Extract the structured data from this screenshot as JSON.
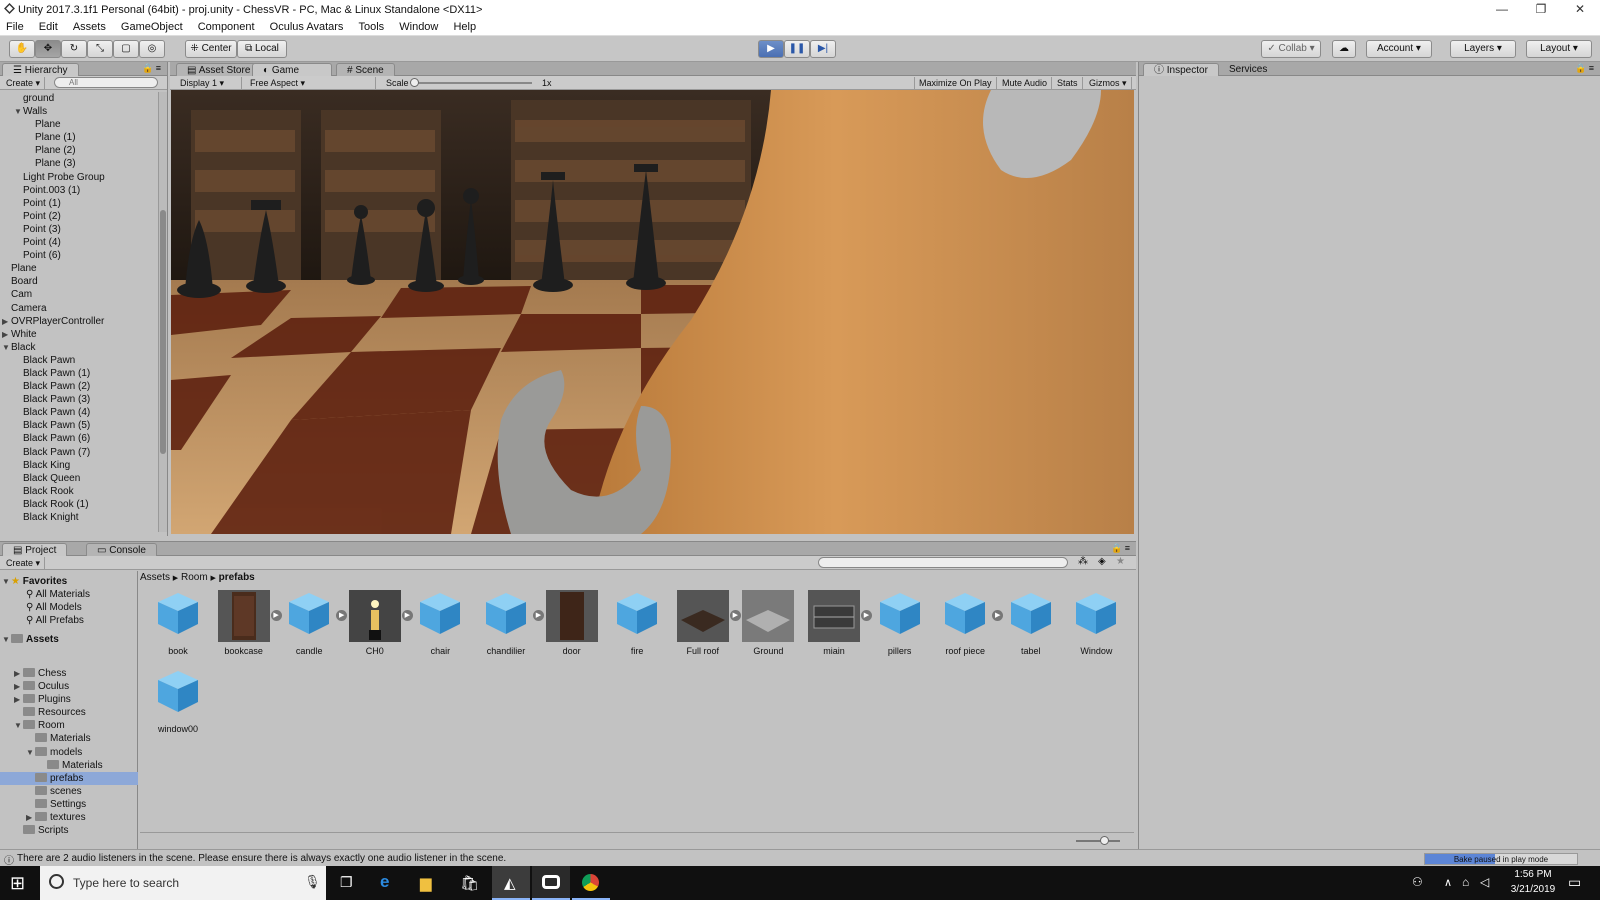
{
  "window": {
    "title": "Unity 2017.3.1f1 Personal (64bit) - proj.unity - ChessVR - PC, Mac & Linux Standalone <DX11>",
    "controls": [
      "—",
      "❐",
      "✕"
    ]
  },
  "menu": [
    "File",
    "Edit",
    "Assets",
    "GameObject",
    "Component",
    "Oculus Avatars",
    "Tools",
    "Window",
    "Help"
  ],
  "toolbar": {
    "pivot": "Center",
    "space": "Local",
    "collab": "Collab",
    "account": "Account",
    "layers": "Layers",
    "layout": "Layout"
  },
  "hierarchy": {
    "tab": "Hierarchy",
    "create": "Create",
    "search_placeholder": "All",
    "items": [
      {
        "label": "ground",
        "depth": 2,
        "arrow": ""
      },
      {
        "label": "Walls",
        "depth": 2,
        "arrow": "open"
      },
      {
        "label": "Plane",
        "depth": 3,
        "arrow": ""
      },
      {
        "label": "Plane (1)",
        "depth": 3,
        "arrow": ""
      },
      {
        "label": "Plane (2)",
        "depth": 3,
        "arrow": ""
      },
      {
        "label": "Plane (3)",
        "depth": 3,
        "arrow": ""
      },
      {
        "label": "Light Probe Group",
        "depth": 2,
        "arrow": ""
      },
      {
        "label": "Point.003 (1)",
        "depth": 2,
        "arrow": ""
      },
      {
        "label": "Point (1)",
        "depth": 2,
        "arrow": ""
      },
      {
        "label": "Point (2)",
        "depth": 2,
        "arrow": ""
      },
      {
        "label": "Point (3)",
        "depth": 2,
        "arrow": ""
      },
      {
        "label": "Point (4)",
        "depth": 2,
        "arrow": ""
      },
      {
        "label": "Point (6)",
        "depth": 2,
        "arrow": ""
      },
      {
        "label": "Plane",
        "depth": 1,
        "arrow": ""
      },
      {
        "label": "Board",
        "depth": 1,
        "arrow": ""
      },
      {
        "label": "Cam",
        "depth": 1,
        "arrow": ""
      },
      {
        "label": "Camera",
        "depth": 1,
        "arrow": ""
      },
      {
        "label": "OVRPlayerController",
        "depth": 1,
        "arrow": "closed"
      },
      {
        "label": "White",
        "depth": 1,
        "arrow": "closed"
      },
      {
        "label": "Black",
        "depth": 1,
        "arrow": "open"
      },
      {
        "label": "Black Pawn",
        "depth": 2,
        "arrow": ""
      },
      {
        "label": "Black Pawn (1)",
        "depth": 2,
        "arrow": ""
      },
      {
        "label": "Black Pawn (2)",
        "depth": 2,
        "arrow": ""
      },
      {
        "label": "Black Pawn (3)",
        "depth": 2,
        "arrow": ""
      },
      {
        "label": "Black Pawn (4)",
        "depth": 2,
        "arrow": ""
      },
      {
        "label": "Black Pawn (5)",
        "depth": 2,
        "arrow": ""
      },
      {
        "label": "Black Pawn (6)",
        "depth": 2,
        "arrow": ""
      },
      {
        "label": "Black Pawn (7)",
        "depth": 2,
        "arrow": ""
      },
      {
        "label": "Black King",
        "depth": 2,
        "arrow": ""
      },
      {
        "label": "Black Queen",
        "depth": 2,
        "arrow": ""
      },
      {
        "label": "Black Rook",
        "depth": 2,
        "arrow": ""
      },
      {
        "label": "Black Rook (1)",
        "depth": 2,
        "arrow": ""
      },
      {
        "label": "Black Knight",
        "depth": 2,
        "arrow": ""
      }
    ]
  },
  "center_tabs": [
    "Asset Store",
    "Game",
    "Scene"
  ],
  "game": {
    "display": "Display 1",
    "aspect": "Free Aspect",
    "scale_label": "Scale",
    "scale_value": "1x",
    "maximize": "Maximize On Play",
    "mute": "Mute Audio",
    "stats": "Stats",
    "gizmos": "Gizmos"
  },
  "right_tabs": [
    "Inspector",
    "Services"
  ],
  "project": {
    "tabs": [
      "Project",
      "Console"
    ],
    "create": "Create",
    "favorites_label": "Favorites",
    "favorites": [
      "All Materials",
      "All Models",
      "All Prefabs"
    ],
    "assets_label": "Assets",
    "tree": [
      {
        "label": "Chess",
        "depth": 1,
        "arrow": "closed"
      },
      {
        "label": "Oculus",
        "depth": 1,
        "arrow": "closed"
      },
      {
        "label": "Plugins",
        "depth": 1,
        "arrow": "closed"
      },
      {
        "label": "Resources",
        "depth": 1,
        "arrow": ""
      },
      {
        "label": "Room",
        "depth": 1,
        "arrow": "open"
      },
      {
        "label": "Materials",
        "depth": 2,
        "arrow": ""
      },
      {
        "label": "models",
        "depth": 2,
        "arrow": "open"
      },
      {
        "label": "Materials",
        "depth": 3,
        "arrow": ""
      },
      {
        "label": "prefabs",
        "depth": 2,
        "arrow": "",
        "selected": true
      },
      {
        "label": "scenes",
        "depth": 2,
        "arrow": ""
      },
      {
        "label": "Settings",
        "depth": 2,
        "arrow": ""
      },
      {
        "label": "textures",
        "depth": 2,
        "arrow": "closed"
      },
      {
        "label": "Scripts",
        "depth": 1,
        "arrow": ""
      }
    ],
    "breadcrumb": [
      "Assets",
      "Room",
      "prefabs"
    ],
    "assets": [
      {
        "name": "book",
        "kind": "cube",
        "expand": false
      },
      {
        "name": "bookcase",
        "kind": "bookcase",
        "expand": true
      },
      {
        "name": "candle",
        "kind": "cube",
        "expand": true
      },
      {
        "name": "CH0",
        "kind": "candle",
        "expand": true
      },
      {
        "name": "chair",
        "kind": "cube",
        "expand": false
      },
      {
        "name": "chandilier",
        "kind": "cube",
        "expand": true
      },
      {
        "name": "door",
        "kind": "door",
        "expand": false
      },
      {
        "name": "fire",
        "kind": "cube",
        "expand": false
      },
      {
        "name": "Full roof",
        "kind": "roof",
        "expand": true
      },
      {
        "name": "Ground",
        "kind": "ground",
        "expand": false
      },
      {
        "name": "miain",
        "kind": "main",
        "expand": true
      },
      {
        "name": "pillers",
        "kind": "cube",
        "expand": false
      },
      {
        "name": "roof piece",
        "kind": "cube",
        "expand": true
      },
      {
        "name": "tabel",
        "kind": "cube",
        "expand": false
      },
      {
        "name": "Window",
        "kind": "cube",
        "expand": false
      },
      {
        "name": "window00",
        "kind": "cube",
        "expand": false
      }
    ]
  },
  "status": {
    "message": "There are 2 audio listeners in the scene. Please ensure there is always exactly one audio listener in the scene.",
    "bake": "Bake paused in play mode"
  },
  "taskbar": {
    "search_placeholder": "Type here to search",
    "time": "1:56 PM",
    "date": "3/21/2019"
  },
  "colors": {
    "accent": "#4a6fb3",
    "selection": "#8da8d8",
    "cube": "#4ea6df"
  }
}
